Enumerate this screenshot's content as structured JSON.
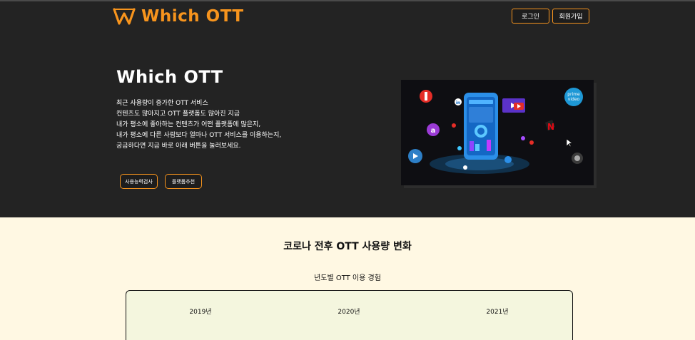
{
  "header": {
    "brand": "Which OTT",
    "login_label": "로그인",
    "signup_label": "회원가입"
  },
  "hero": {
    "title": "Which OTT",
    "lines": [
      "최근 사용량이 증가한 OTT 서비스",
      "컨텐츠도 많아지고 OTT 플랫폼도 많아진 지금",
      "내가 평소에 좋아하는 컨텐츠가 어떤 플랫폼에 많은지,",
      "내가 평소에 다른 사람보다 얼마나 OTT 서비스를 이용하는지,",
      "궁금하다면 지금 바로 아래 버튼을 눌러보세요."
    ],
    "btn_usage": "사용능력검사",
    "btn_recommend": "플랫폼추천",
    "illustration_icons": [
      "netflix-icon",
      "prime-video-icon",
      "youtube-icon",
      "linkedin-icon",
      "phone-icon"
    ]
  },
  "section": {
    "title": "코로나 전후 OTT 사용량 변화",
    "subtitle": "년도별 OTT 이용 경험",
    "years": [
      "2019년",
      "2020년",
      "2021년"
    ]
  },
  "colors": {
    "accent": "#f7941d",
    "dark_bg": "#232323",
    "cream_bg": "#fff8e3",
    "card_bg": "#f4f6de"
  }
}
